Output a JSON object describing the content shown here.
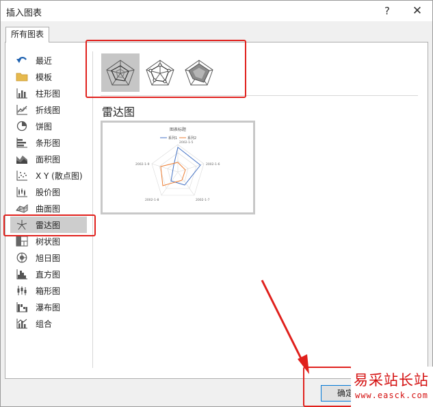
{
  "window": {
    "title": "插入图表",
    "help_glyph": "?",
    "close_glyph": "✕"
  },
  "tabs": [
    {
      "label": "所有图表"
    }
  ],
  "sidebar": {
    "items": [
      {
        "label": "最近",
        "icon": "undo-arrow-icon"
      },
      {
        "label": "模板",
        "icon": "folder-icon"
      },
      {
        "label": "柱形图",
        "icon": "column-chart-icon"
      },
      {
        "label": "折线图",
        "icon": "line-chart-icon"
      },
      {
        "label": "饼图",
        "icon": "pie-chart-icon"
      },
      {
        "label": "条形图",
        "icon": "bar-chart-icon"
      },
      {
        "label": "面积图",
        "icon": "area-chart-icon"
      },
      {
        "label": "X Y (散点图)",
        "icon": "scatter-chart-icon"
      },
      {
        "label": "股价图",
        "icon": "stock-chart-icon"
      },
      {
        "label": "曲面图",
        "icon": "surface-chart-icon"
      },
      {
        "label": "雷达图",
        "icon": "radar-chart-icon",
        "selected": true
      },
      {
        "label": "树状图",
        "icon": "treemap-chart-icon"
      },
      {
        "label": "旭日图",
        "icon": "sunburst-chart-icon"
      },
      {
        "label": "直方图",
        "icon": "histogram-chart-icon"
      },
      {
        "label": "箱形图",
        "icon": "box-whisker-chart-icon"
      },
      {
        "label": "瀑布图",
        "icon": "waterfall-chart-icon"
      },
      {
        "label": "组合",
        "icon": "combo-chart-icon"
      }
    ]
  },
  "main": {
    "chart_type_title": "雷达图",
    "subtypes": [
      {
        "icon": "radar-icon",
        "selected": true
      },
      {
        "icon": "radar-markers-icon",
        "selected": false
      },
      {
        "icon": "filled-radar-icon",
        "selected": false
      }
    ],
    "preview": {
      "title": "图表标题",
      "legend": [
        "系列1",
        "系列2"
      ],
      "axis_labels": [
        "2002-1-5",
        "2002-1-6",
        "2002-1-7",
        "2002-1-8",
        "2002-1-9"
      ],
      "series_colors": [
        "#4472c4",
        "#ed7d31"
      ]
    }
  },
  "footer": {
    "ok_label": "确定"
  },
  "watermark": {
    "main": "易采站长站",
    "sub": "www.easck.com"
  },
  "colors": {
    "highlight_red": "#e0201c",
    "selected_gray": "#cdcdcd",
    "watermark_red": "#d40f0f"
  }
}
